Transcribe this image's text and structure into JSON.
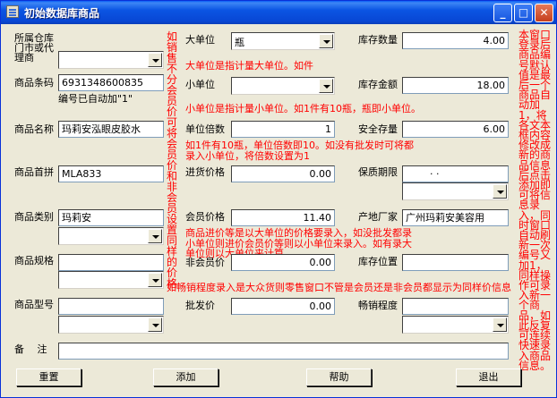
{
  "window": {
    "title": "初始数据库商品"
  },
  "labels": {
    "warehouse": "所属仓库",
    "store_or_supplier_1": "门市或代",
    "store_or_supplier_2": "理商",
    "barcode": "商品条码",
    "name": "商品名称",
    "pinyin": "商品首拼",
    "category": "商品类别",
    "spec": "商品规格",
    "model": "商品型号",
    "remark": "备　 注",
    "big_unit": "大单位",
    "small_unit": "小单位",
    "unit_multiple": "单位倍数",
    "purchase_price": "进货价格",
    "member_price": "会员价格",
    "non_member_price": "非会员价",
    "wholesale_price": "批发价",
    "stock_qty": "库存数量",
    "stock_amount": "库存金额",
    "safety_stock": "安全存量",
    "shelf_life": "保质期限",
    "manufacturer": "产地厂家",
    "stock_location": "库存位置",
    "sales_level": "畅销程度"
  },
  "values": {
    "barcode": "6931348600835",
    "barcode_note": "编号已自动加\"1\"",
    "name": "玛莉安泓眼皮胶水",
    "pinyin": "MLA833",
    "category": "玛莉安",
    "big_unit": "瓶",
    "unit_multiple": "1",
    "purchase_price": "0.00",
    "member_price": "11.40",
    "non_member_price": "0.00",
    "wholesale_price": "0.00",
    "stock_qty": "4.00",
    "stock_amount": "18.00",
    "safety_stock": "6.00",
    "shelf_life": "·     ·",
    "manufacturer": "广州玛莉安美容用"
  },
  "notes": {
    "left_vertical": "如销售不分会员价可将会员价和非会员设置同样的价格",
    "big_unit": "大单位是指计量大单位。如件",
    "small_unit": "小单位是指计量小单位。如1件有10瓶，瓶即小单位。",
    "multiple_1": "如1件有10瓶，单位倍数即10。如没有批发时可将都",
    "multiple_2": "录入小单位，将倍数设置为1",
    "price_1": "商品进价等是以大单位的价格要录入，如没批发都录",
    "price_2": "小单位则进价会员价等则以小单位来录入。如有录大",
    "price_3": "单位则以大单位来计算。",
    "sales": "如畅销程度录入是大众货则零售窗口不管是会员还是非会员都显示为同样价信息",
    "right_vertical": "本窗口登录后商品编号默认值是最后一个商品自动加1，将各文本框内容修改成新的商品信息后点击添加即可将信息录入，同时窗口自动刷新一次编号又加1，同样操作可录入新一个商品，如此反复可连续快速录入商品信息。"
  },
  "buttons": {
    "reset": "重置",
    "add": "添加",
    "help": "帮助",
    "exit": "退出"
  },
  "titlebar_buttons": {
    "minimize": "_",
    "maximize": "□",
    "close": "✕"
  }
}
